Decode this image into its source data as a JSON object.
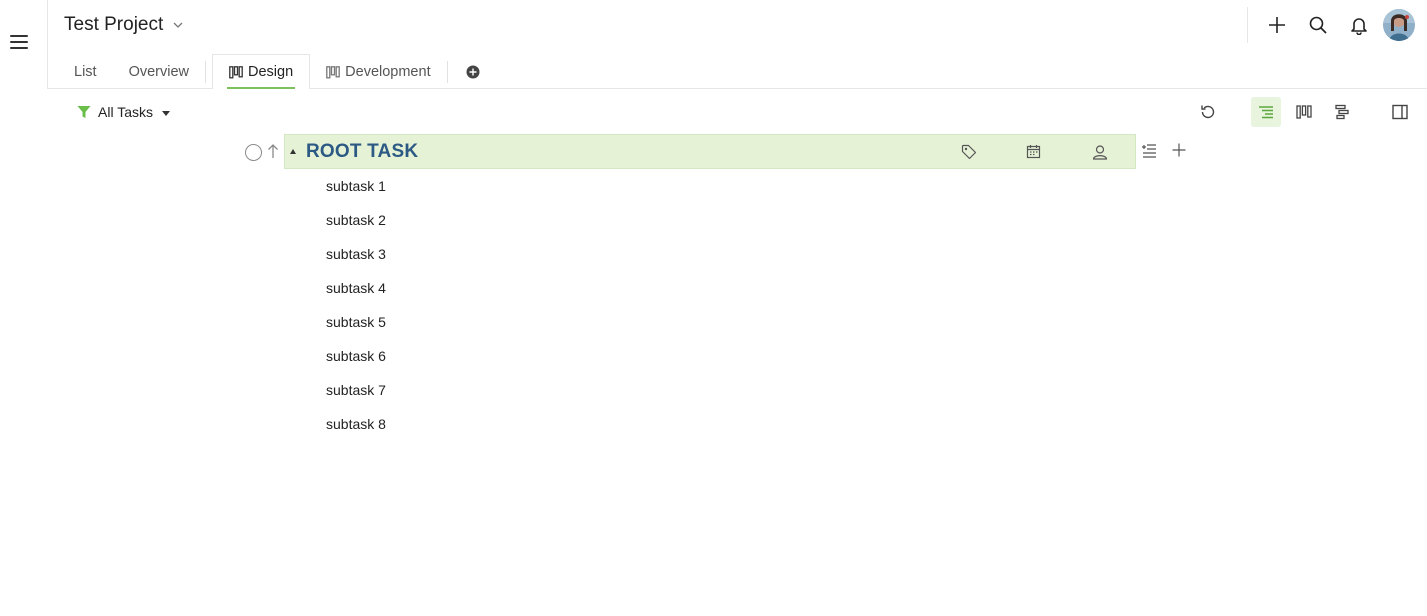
{
  "project": {
    "title": "Test Project"
  },
  "tabs": [
    {
      "label": "List"
    },
    {
      "label": "Overview"
    },
    {
      "label": "Design"
    },
    {
      "label": "Development"
    }
  ],
  "filter": {
    "label": "All Tasks"
  },
  "root_task": {
    "title": "ROOT TASK"
  },
  "subtasks": [
    "subtask 1",
    "subtask 2",
    "subtask 3",
    "subtask 4",
    "subtask 5",
    "subtask 6",
    "subtask 7",
    "subtask 8"
  ],
  "colors": {
    "accent": "#7cc15c",
    "root_bg": "#e5f2d6",
    "root_title": "#2c5a85",
    "filter_icon": "#6abf4b"
  },
  "icons": {
    "menu": "hamburger-icon",
    "add": "plus-icon",
    "search": "search-icon",
    "notifications": "bell-icon",
    "refresh": "refresh-icon",
    "tree_view": "tree-view-icon",
    "board_view": "board-view-icon",
    "gantt_view": "gantt-view-icon",
    "panel": "side-panel-icon"
  }
}
